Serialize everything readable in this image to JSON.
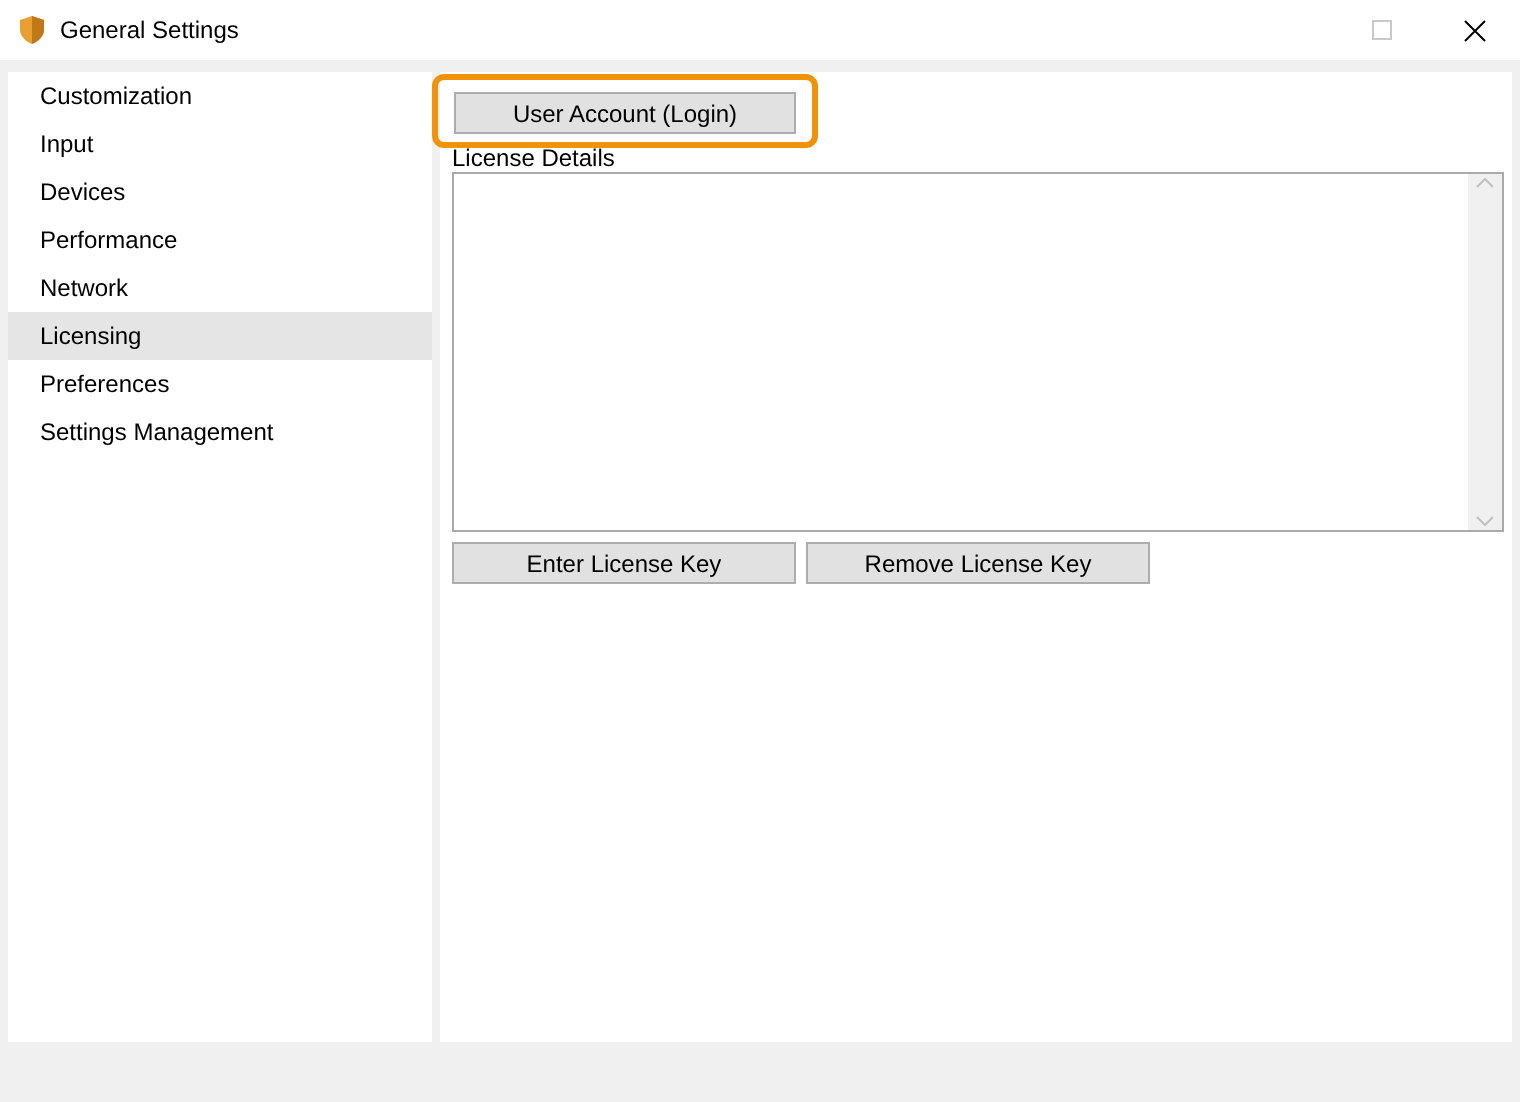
{
  "window": {
    "title": "General Settings",
    "maximize_disabled": true
  },
  "sidebar": {
    "items": [
      {
        "label": "Customization",
        "selected": false
      },
      {
        "label": "Input",
        "selected": false
      },
      {
        "label": "Devices",
        "selected": false
      },
      {
        "label": "Performance",
        "selected": false
      },
      {
        "label": "Network",
        "selected": false
      },
      {
        "label": "Licensing",
        "selected": true
      },
      {
        "label": "Preferences",
        "selected": false
      },
      {
        "label": "Settings Management",
        "selected": false
      }
    ]
  },
  "content": {
    "account_button": {
      "label": "User Account (Login)",
      "highlighted": true
    },
    "details_label": "License Details",
    "buttons": [
      "Enter License Key",
      "Remove License Key"
    ]
  }
}
